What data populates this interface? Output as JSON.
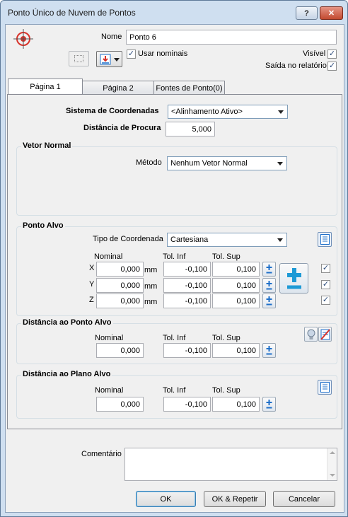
{
  "window": {
    "title": "Ponto Único de Nuvem de Pontos"
  },
  "header": {
    "name_label": "Nome",
    "name_value": "Ponto 6",
    "use_nominals_label": "Usar nominais",
    "use_nominals_checked": true,
    "visible_label": "Visível",
    "visible_checked": true,
    "report_output_label": "Saída no relatório",
    "report_output_checked": true
  },
  "tabs": [
    {
      "label": "Página 1",
      "active": true
    },
    {
      "label": "Página 2",
      "active": false
    },
    {
      "label": "Fontes de Ponto(0)",
      "active": false
    }
  ],
  "page1": {
    "coord_system_label": "Sistema de Coordenadas",
    "coord_system_value": "<Alinhamento Ativo>",
    "search_distance_label": "Distância de Procura",
    "search_distance_value": "5,000",
    "normal_vector": {
      "title": "Vetor Normal",
      "method_label": "Método",
      "method_value": "Nenhum Vetor Normal"
    },
    "target_point": {
      "title": "Ponto Alvo",
      "coord_type_label": "Tipo de Coordenada",
      "coord_type_value": "Cartesiana",
      "col_nominal": "Nominal",
      "col_tol_inf": "Tol. Inf",
      "col_tol_sup": "Tol. Sup",
      "unit": "mm",
      "rows": [
        {
          "axis": "X",
          "nominal": "0,000",
          "tol_inf": "-0,100",
          "tol_sup": "0,100",
          "checked": true
        },
        {
          "axis": "Y",
          "nominal": "0,000",
          "tol_inf": "-0,100",
          "tol_sup": "0,100",
          "checked": true
        },
        {
          "axis": "Z",
          "nominal": "0,000",
          "tol_inf": "-0,100",
          "tol_sup": "0,100",
          "checked": true
        }
      ]
    },
    "target_point_distance": {
      "title": "Distância ao Ponto Alvo",
      "col_nominal": "Nominal",
      "col_tol_inf": "Tol. Inf",
      "col_tol_sup": "Tol. Sup",
      "nominal": "0,000",
      "tol_inf": "-0,100",
      "tol_sup": "0,100"
    },
    "target_plane_distance": {
      "title": "Distância ao Plano Alvo",
      "col_nominal": "Nominal",
      "col_tol_inf": "Tol. Inf",
      "col_tol_sup": "Tol. Sup",
      "nominal": "0,000",
      "tol_inf": "-0,100",
      "tol_sup": "0,100"
    }
  },
  "comment": {
    "label": "Comentário",
    "value": ""
  },
  "buttons": {
    "ok": "OK",
    "ok_repeat": "OK & Repetir",
    "cancel": "Cancelar"
  },
  "colors": {
    "accent_blue": "#1e6fc9",
    "target_red": "#d8322a"
  }
}
